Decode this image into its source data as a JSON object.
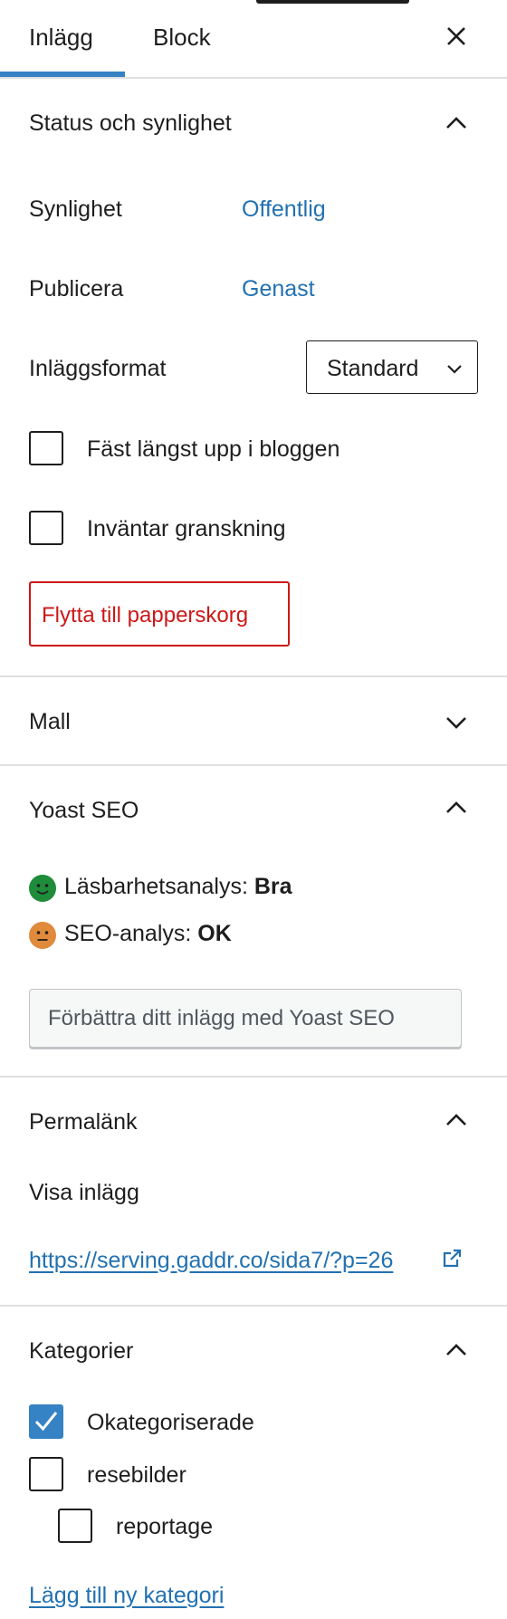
{
  "tabs": {
    "post": "Inlägg",
    "block": "Block",
    "active": "Inlägg"
  },
  "status": {
    "title": "Status och synlighet",
    "visibility_label": "Synlighet",
    "visibility_value": "Offentlig",
    "publish_label": "Publicera",
    "publish_value": "Genast",
    "format_label": "Inläggsformat",
    "format_value": "Standard",
    "sticky_label": "Fäst längst upp i bloggen",
    "sticky_checked": false,
    "pending_label": "Inväntar granskning",
    "pending_checked": false,
    "trash_button": "Flytta till papperskorg"
  },
  "template": {
    "title": "Mall"
  },
  "yoast": {
    "title": "Yoast SEO",
    "readability_label": "Läsbarhetsanalys:",
    "readability_value": "Bra",
    "seo_label": "SEO-analys:",
    "seo_value": "OK",
    "improve_button": "Förbättra ditt inlägg med Yoast SEO",
    "colors": {
      "good": "#1e8c3a",
      "ok": "#e08a3c"
    }
  },
  "permalink": {
    "title": "Permalänk",
    "view_label": "Visa inlägg",
    "url": "https://serving.gaddr.co/sida7/?p=26"
  },
  "categories": {
    "title": "Kategorier",
    "items": [
      {
        "label": "Okategoriserade",
        "checked": true
      },
      {
        "label": "resebilder",
        "checked": false
      },
      {
        "label": "reportage",
        "checked": false
      }
    ],
    "add_link": "Lägg till ny kategori"
  },
  "colors": {
    "accent": "#3582c4",
    "link": "#2271b1",
    "danger": "#cc1818",
    "text": "#1e1e1e",
    "divider": "#e0e0e0"
  }
}
